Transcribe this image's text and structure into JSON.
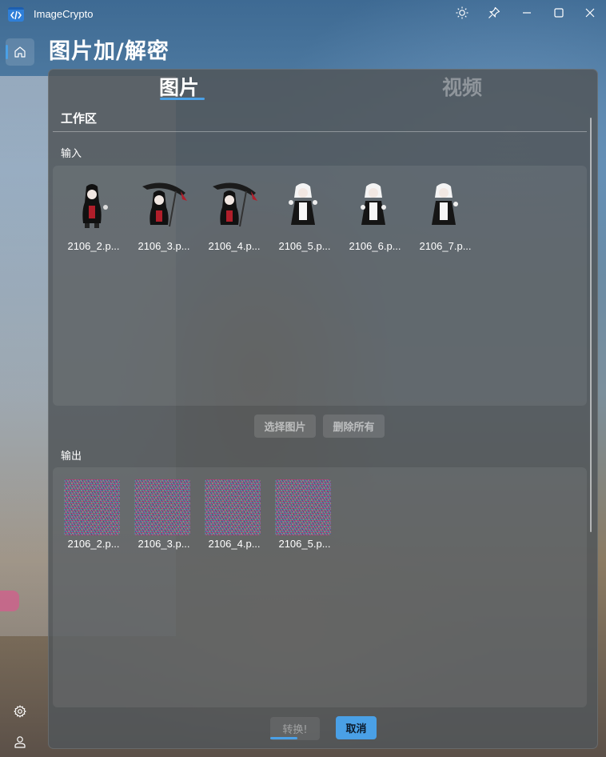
{
  "window": {
    "title": "ImageCrypto"
  },
  "page": {
    "title": "图片加/解密"
  },
  "tabs": [
    {
      "label": "图片",
      "selected": true
    },
    {
      "label": "视频",
      "selected": false
    }
  ],
  "workspace": {
    "heading": "工作区"
  },
  "input": {
    "label": "输入",
    "files": [
      "2106_2.p...",
      "2106_3.p...",
      "2106_4.p...",
      "2106_5.p...",
      "2106_6.p...",
      "2106_7.p..."
    ]
  },
  "actions": {
    "select_images": "选择图片",
    "delete_all": "删除所有"
  },
  "output": {
    "label": "输出",
    "files": [
      "2106_2.p...",
      "2106_3.p...",
      "2106_4.p...",
      "2106_5.p..."
    ]
  },
  "footer": {
    "convert": "转换!",
    "cancel": "取消"
  },
  "icons": {
    "app": "code-icon",
    "theme": "sun-icon",
    "pin": "pin-icon",
    "minimize": "minimize-icon",
    "maximize": "maximize-icon",
    "close": "close-icon",
    "home": "home-icon",
    "settings": "gear-icon",
    "account": "user-icon"
  },
  "colors": {
    "accent": "#4aa0e6"
  }
}
